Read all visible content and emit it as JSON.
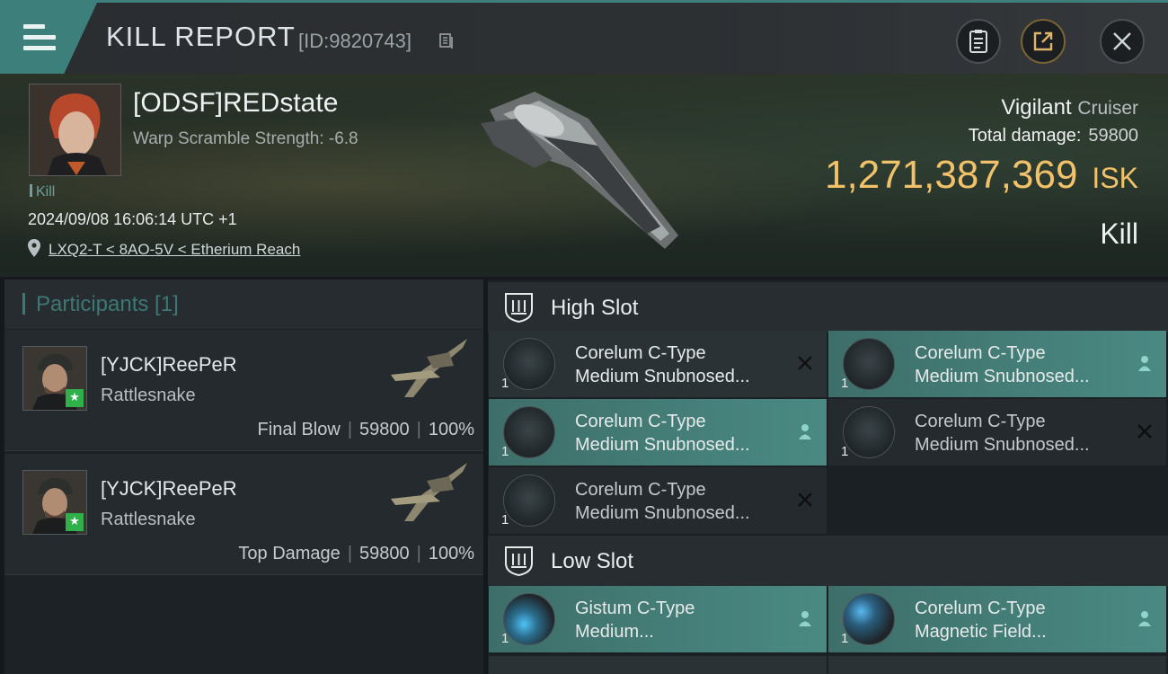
{
  "titlebar": {
    "title": "KILL REPORT",
    "report_id": "[ID:9820743]",
    "buttons": [
      "clipboard-icon",
      "share-icon",
      "close-icon"
    ]
  },
  "victim": {
    "name": "[ODSF]REDstate",
    "warp_scramble": "Warp Scramble Strength: -6.8",
    "kill_tag": "Kill",
    "datetime": "2024/09/08 16:06:14 UTC +1",
    "location": "LXQ2-T < 8AO-5V < Etherium Reach"
  },
  "ship": {
    "name": "Vigilant",
    "class": "Cruiser",
    "total_damage_label": "Total damage:",
    "total_damage": "59800",
    "isk_value": "1,271,387,369",
    "isk_label": "ISK",
    "result": "Kill"
  },
  "participants": {
    "header": "Participants [1]",
    "items": [
      {
        "name": "[YJCK]ReePeR",
        "ship": "Rattlesnake",
        "role": "Final Blow",
        "damage": "59800",
        "percent": "100%"
      },
      {
        "name": "[YJCK]ReePeR",
        "ship": "Rattlesnake",
        "role": "Top Damage",
        "damage": "59800",
        "percent": "100%"
      }
    ]
  },
  "high_slot": {
    "label": "High Slot",
    "modules": [
      {
        "line1": "Corelum C-Type",
        "line2": "Medium Snubnosed...",
        "qty": "1",
        "mark": "destroyed-x-icon"
      },
      {
        "line1": "Corelum C-Type",
        "line2": "Medium Snubnosed...",
        "qty": "1",
        "mark": "dropped-person-icon"
      },
      {
        "line1": "Corelum C-Type",
        "line2": "Medium Snubnosed...",
        "qty": "1",
        "mark": "dropped-person-icon"
      },
      {
        "line1": "Corelum C-Type",
        "line2": "Medium Snubnosed...",
        "qty": "1",
        "mark": "destroyed-x-icon"
      },
      {
        "line1": "Corelum C-Type",
        "line2": "Medium Snubnosed...",
        "qty": "1",
        "mark": "destroyed-x-icon"
      }
    ]
  },
  "low_slot": {
    "label": "Low Slot",
    "modules": [
      {
        "line1": "Gistum C-Type",
        "line2": "Medium...",
        "qty": "1",
        "mark": "dropped-person-icon"
      },
      {
        "line1": "Corelum C-Type",
        "line2": "Magnetic Field...",
        "qty": "1",
        "mark": "dropped-person-icon"
      }
    ]
  },
  "colors": {
    "accent_teal": "#3d807b",
    "isk_gold": "#f2c26a",
    "badge_green": "#2fb04a"
  }
}
